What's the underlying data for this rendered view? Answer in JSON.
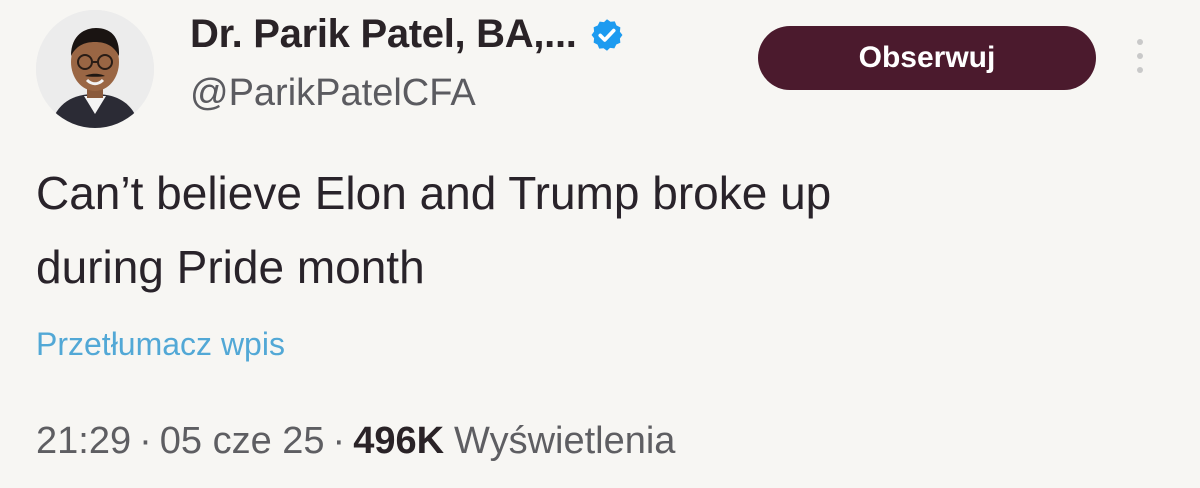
{
  "author": {
    "display_name": "Dr. Parik Patel, BA,...",
    "handle": "@ParikPatelCFA",
    "verified_icon": "verified-badge-icon",
    "avatar": "avatar-photo"
  },
  "actions": {
    "follow_label": "Obserwuj",
    "more_icon": "more-vertical-icon"
  },
  "tweet": {
    "text_line_1": "Can’t believe Elon and Trump broke up",
    "text_line_2": "during Pride month",
    "translate_label": "Przetłumacz wpis"
  },
  "meta": {
    "time": "21:29",
    "separator": "·",
    "date": "05 cze 25",
    "views_count": "496K",
    "views_label": "Wyświetlenia"
  },
  "colors": {
    "background": "#f7f6f3",
    "follow_button": "#4b1a2d",
    "link": "#52a8d6",
    "verified": "#1d9bf0"
  }
}
